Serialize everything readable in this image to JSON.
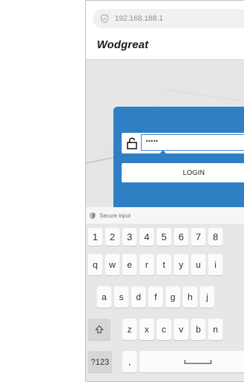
{
  "browser": {
    "url": "192.168.188.1"
  },
  "header": {
    "brand": "Wodgreat"
  },
  "login": {
    "password_masked": "•••••",
    "button_label": "LOGIN"
  },
  "keyboard": {
    "secure_label": "Secure input",
    "numbers": [
      "1",
      "2",
      "3",
      "4",
      "5",
      "6",
      "7",
      "8"
    ],
    "row1": [
      "q",
      "w",
      "e",
      "r",
      "t",
      "y",
      "u",
      "i"
    ],
    "row2": [
      "a",
      "s",
      "d",
      "f",
      "g",
      "h",
      "j"
    ],
    "row3": [
      "z",
      "x",
      "c",
      "v",
      "b",
      "n"
    ],
    "symbols_label": "?123",
    "comma_label": ","
  },
  "colors": {
    "accent": "#2f7fc4",
    "keyboard_bg": "#e7e7ea",
    "key_bg": "#fbfbfb"
  },
  "icons": [
    "shield-icon",
    "lock-icon",
    "cursor-handle-icon",
    "shift-icon",
    "space-icon"
  ]
}
